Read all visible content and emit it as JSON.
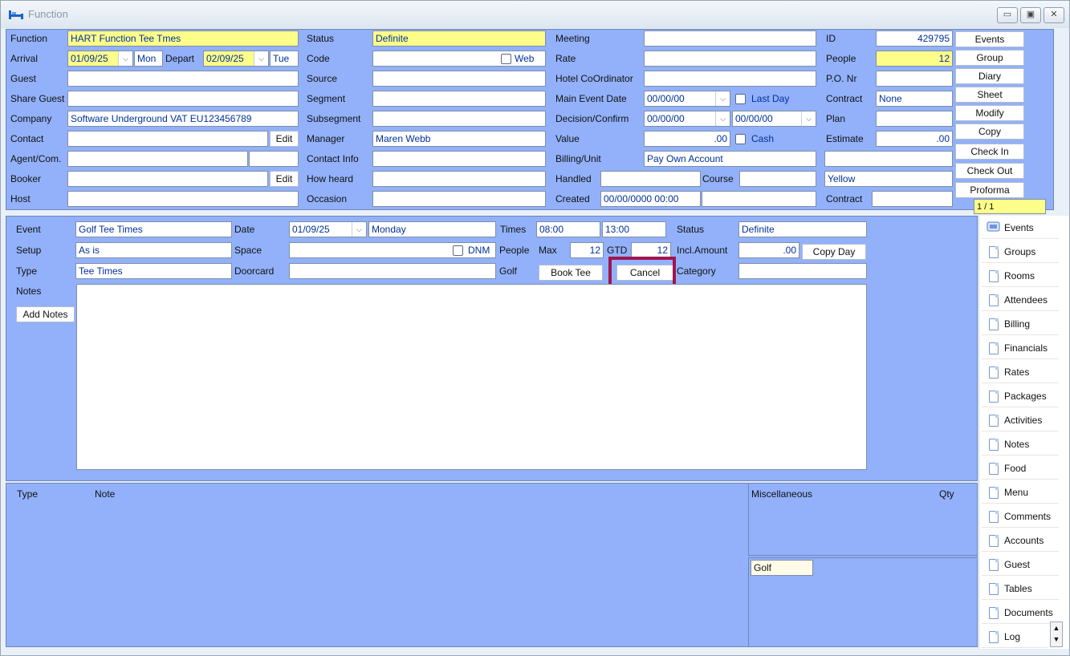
{
  "window": {
    "title": "Function",
    "icon": "bed-icon"
  },
  "header": {
    "function_label": "Function",
    "function_value": "HART Function Tee Tmes",
    "arrival_label": "Arrival",
    "arrival_value": "01/09/25",
    "arrival_day": "Mon",
    "depart_label": "Depart",
    "depart_value": "02/09/25",
    "depart_day": "Tue",
    "guest_label": "Guest",
    "share_guest_label": "Share Guest",
    "company_label": "Company",
    "company_value": "Software Underground VAT EU123456789",
    "contact_label": "Contact",
    "contact_edit": "Edit",
    "agent_label": "Agent/Com.",
    "booker_label": "Booker",
    "booker_edit": "Edit",
    "host_label": "Host",
    "status_label": "Status",
    "status_value": "Definite",
    "code_label": "Code",
    "web_label": "Web",
    "source_label": "Source",
    "segment_label": "Segment",
    "subsegment_label": "Subsegment",
    "manager_label": "Manager",
    "manager_value": "Maren  Webb",
    "contact_info_label": "Contact Info",
    "how_heard_label": "How heard",
    "occasion_label": "Occasion",
    "meeting_label": "Meeting",
    "rate_label": "Rate",
    "hotel_coord_label": "Hotel CoOrdinator",
    "main_event_date_label": "Main Event Date",
    "main_event_date_value": "00/00/00",
    "last_day_label": "Last Day",
    "decision_label": "Decision/Confirm",
    "decision_value": "00/00/00",
    "confirm_value": "00/00/00",
    "value_label": "Value",
    "value_value": ".00",
    "cash_label": "Cash",
    "billing_label": "Billing/Unit",
    "billing_value": "Pay Own Account",
    "handled_label": "Handled",
    "course_label": "Course",
    "created_label": "Created",
    "created_value": "00/00/0000 00:00",
    "id_label": "ID",
    "id_value": "429795",
    "people_label": "People",
    "people_value": "12",
    "po_label": "P.O. Nr",
    "contract_label": "Contract",
    "contract_value": "None",
    "plan_label": "Plan",
    "estimate_label": "Estimate",
    "estimate_value": ".00",
    "colour_value": "Yellow",
    "contract2_label": "Contract",
    "page_indicator": "1 / 1"
  },
  "action_buttons": [
    "Events",
    "Group",
    "Diary",
    "Sheet",
    "Modify",
    "Copy",
    "Check In",
    "Check Out",
    "Proforma"
  ],
  "event": {
    "event_label": "Event",
    "event_value": "Golf Tee Times",
    "setup_label": "Setup",
    "setup_value": "As is",
    "type_label": "Type",
    "type_value": "Tee Times",
    "notes_label": "Notes",
    "add_notes": "Add Notes",
    "date_label": "Date",
    "date_value": "01/09/25",
    "day_value": "Monday",
    "space_label": "Space",
    "dnm_label": "DNM",
    "doorcard_label": "Doorcard",
    "times_label": "Times",
    "time_from": "08:00",
    "time_to": "13:00",
    "people_label": "People",
    "max_label": "Max",
    "max_value": "12",
    "gtd_label": "GTD",
    "gtd_value": "12",
    "golf_label": "Golf",
    "book_tee": "Book Tee",
    "cancel": "Cancel",
    "status_label": "Status",
    "status_value": "Definite",
    "incl_amount_label": "Incl.Amount",
    "incl_amount_value": ".00",
    "copy_day": "Copy Day",
    "category_label": "Category",
    "highlight_color": "#a0154f"
  },
  "bottom": {
    "type_header": "Type",
    "note_header": "Note",
    "misc_header": "Miscellaneous",
    "qty_header": "Qty",
    "golf_tag": "Golf"
  },
  "side_tabs": [
    "Events",
    "Groups",
    "Rooms",
    "Attendees",
    "Billing",
    "Financials",
    "Rates",
    "Packages",
    "Activities",
    "Notes",
    "Food",
    "Menu",
    "Comments",
    "Accounts",
    "Guest",
    "Tables",
    "Documents",
    "Log"
  ],
  "colors": {
    "panel": "#92b1fa",
    "field_yellow": "#fdfd8a",
    "value_text": "#00319c"
  }
}
